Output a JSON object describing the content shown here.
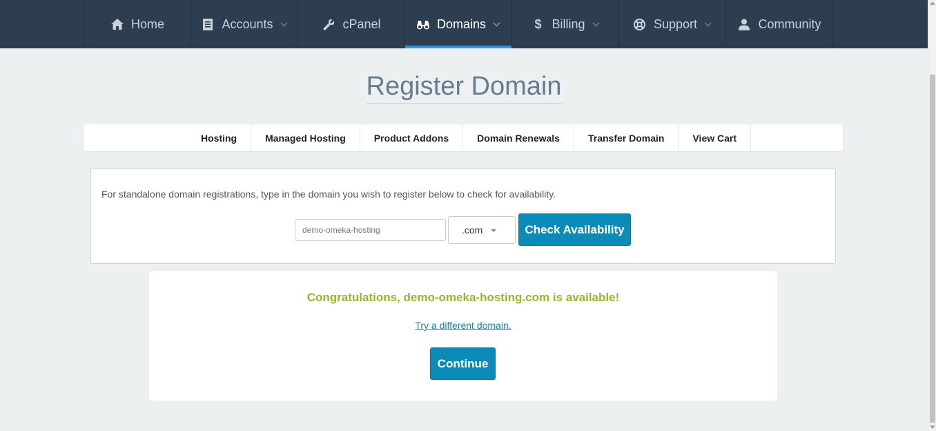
{
  "nav": {
    "items": [
      {
        "label": "Home",
        "icon": "home-icon",
        "dropdown": false,
        "active": false
      },
      {
        "label": "Accounts",
        "icon": "document-icon",
        "dropdown": true,
        "active": false
      },
      {
        "label": "cPanel",
        "icon": "wrench-icon",
        "dropdown": false,
        "active": false
      },
      {
        "label": "Domains",
        "icon": "binoculars-icon",
        "dropdown": true,
        "active": true
      },
      {
        "label": "Billing",
        "icon": "dollar-icon",
        "dropdown": true,
        "active": false
      },
      {
        "label": "Support",
        "icon": "lifebuoy-icon",
        "dropdown": true,
        "active": false
      },
      {
        "label": "Community",
        "icon": "user-icon",
        "dropdown": false,
        "active": false
      }
    ],
    "accent_color": "#3498db",
    "background_color": "#2c3e50"
  },
  "page": {
    "title": "Register Domain"
  },
  "tabs": [
    {
      "label": "Hosting"
    },
    {
      "label": "Managed Hosting"
    },
    {
      "label": "Product Addons"
    },
    {
      "label": "Domain Renewals"
    },
    {
      "label": "Transfer Domain"
    },
    {
      "label": "View Cart"
    }
  ],
  "search": {
    "intro": "For standalone domain registrations, type in the domain you wish to register below to check for availability.",
    "domain_value": "demo-omeka-hosting",
    "tld_selected": ".com",
    "check_label": "Check Availability",
    "button_color": "#0b8bb8"
  },
  "result": {
    "message": "Congratulations, demo-omeka-hosting.com is available!",
    "message_color": "#9ab32e",
    "try_link": "Try a different domain.",
    "continue_label": "Continue"
  }
}
